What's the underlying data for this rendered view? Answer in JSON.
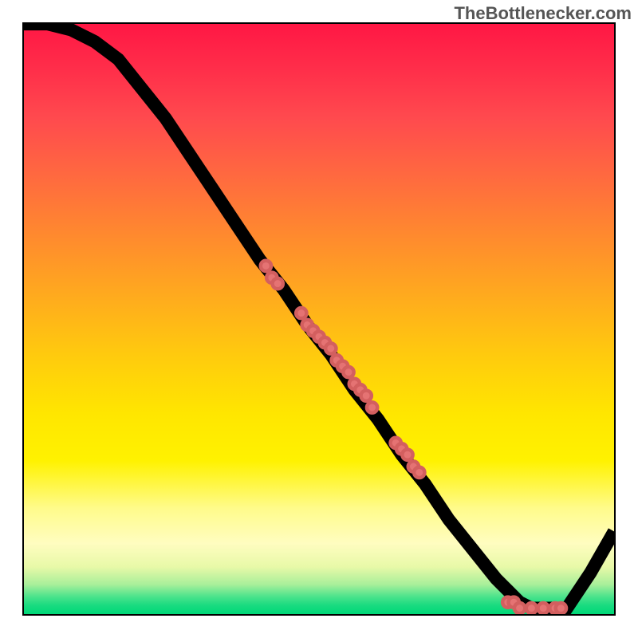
{
  "watermark": "TheBottlenecker.com",
  "chart_data": {
    "type": "line",
    "title": "",
    "xlabel": "",
    "ylabel": "",
    "xlim": [
      0,
      100
    ],
    "ylim": [
      0,
      100
    ],
    "series": [
      {
        "name": "curve",
        "x": [
          0,
          4,
          8,
          12,
          16,
          20,
          24,
          28,
          32,
          36,
          40,
          44,
          48,
          52,
          56,
          60,
          64,
          68,
          72,
          76,
          80,
          82,
          84,
          86,
          88,
          90,
          92,
          96,
          100
        ],
        "y": [
          100,
          100,
          99,
          97,
          94,
          89,
          84,
          78,
          72,
          66,
          60,
          55,
          49,
          44,
          38,
          33,
          27,
          22,
          16,
          11,
          6,
          4,
          2,
          1,
          1,
          1,
          1,
          7,
          14
        ]
      }
    ],
    "scatter": {
      "name": "points",
      "x": [
        41,
        42,
        43,
        47,
        48,
        49,
        50,
        51,
        52,
        53,
        54,
        55,
        56,
        57,
        58,
        59,
        63,
        64,
        65,
        66,
        67,
        82,
        83,
        84,
        86,
        88,
        90,
        91
      ],
      "y": [
        59,
        57,
        56,
        51,
        49,
        48,
        47,
        46,
        45,
        43,
        42,
        41,
        39,
        38,
        37,
        35,
        29,
        28,
        27,
        25,
        24,
        2,
        2,
        1,
        1,
        1,
        1,
        1
      ]
    }
  }
}
